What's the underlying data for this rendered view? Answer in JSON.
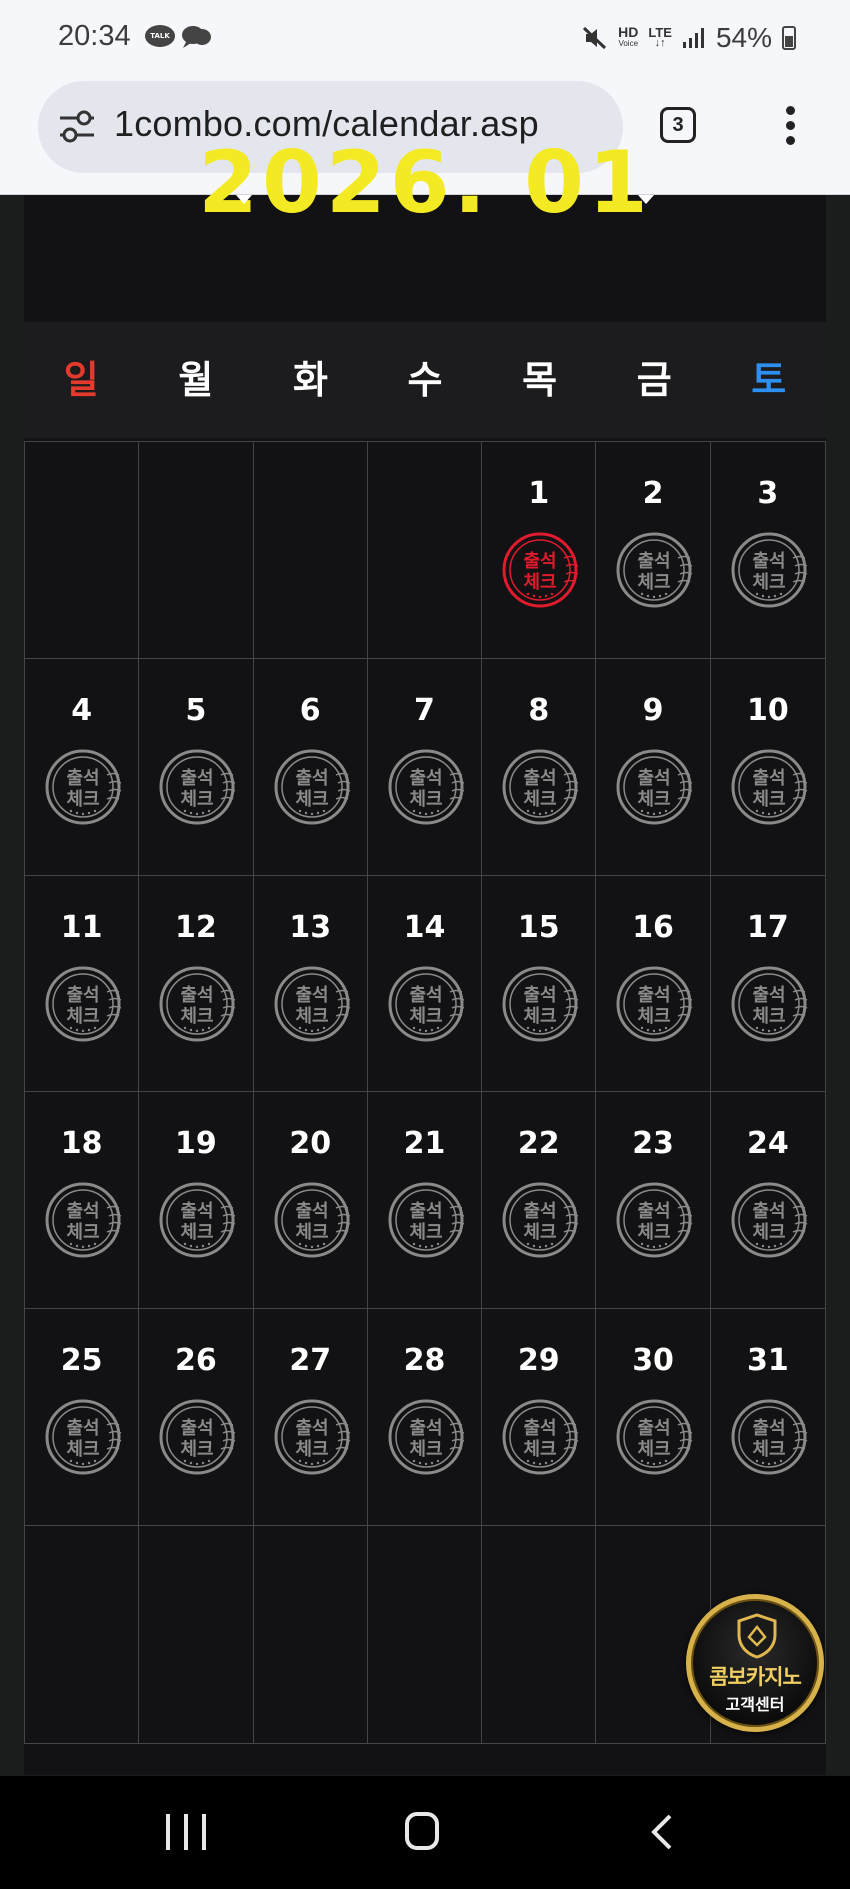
{
  "status_bar": {
    "time": "20:34",
    "talk_badge": "TALK",
    "network_hd": "HD",
    "network_voice": "Voice",
    "network_lte": "LTE",
    "battery": "54%"
  },
  "browser": {
    "url": "1combo.com/calendar.asp",
    "tab_count": "3"
  },
  "calendar": {
    "month_label": "2026. 01",
    "weekdays": [
      "일",
      "월",
      "화",
      "수",
      "목",
      "금",
      "토"
    ],
    "stamp_text_line1": "출석",
    "stamp_text_line2": "체크",
    "checked_days": [
      1
    ],
    "weeks": [
      [
        "",
        "",
        "",
        "",
        "1",
        "2",
        "3"
      ],
      [
        "4",
        "5",
        "6",
        "7",
        "8",
        "9",
        "10"
      ],
      [
        "11",
        "12",
        "13",
        "14",
        "15",
        "16",
        "17"
      ],
      [
        "18",
        "19",
        "20",
        "21",
        "22",
        "23",
        "24"
      ],
      [
        "25",
        "26",
        "27",
        "28",
        "29",
        "30",
        "31"
      ],
      [
        "",
        "",
        "",
        "",
        "",
        "",
        ""
      ]
    ],
    "colors": {
      "title": "#f3ea24",
      "sunday": "#e43a2e",
      "saturday": "#2d8ff0",
      "checked_stamp": "#e01b2e",
      "unchecked_stamp": "#8a8a8a"
    }
  },
  "support_badge": {
    "title": "콤보카지노",
    "subtitle": "고객센터"
  }
}
